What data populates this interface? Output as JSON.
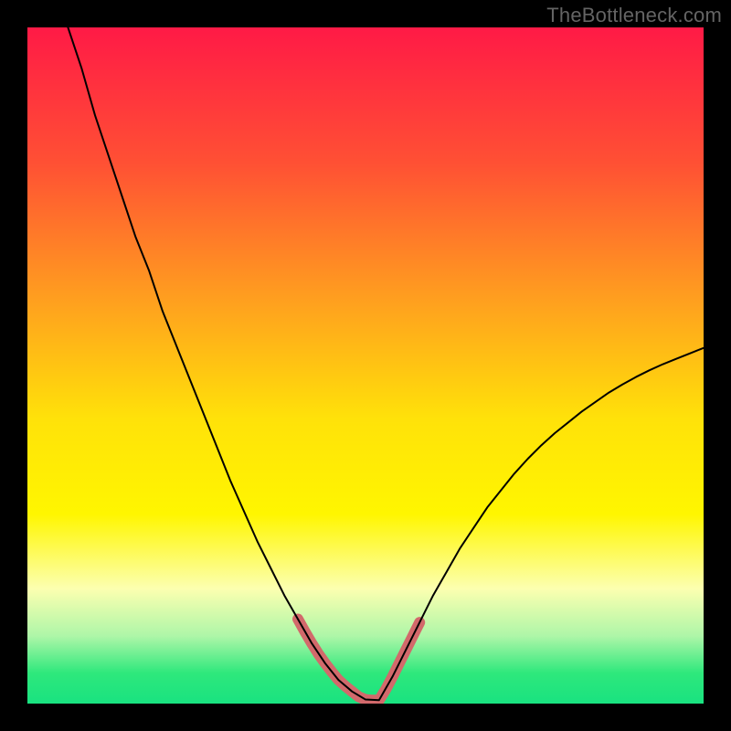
{
  "watermark": "TheBottleneck.com",
  "chart_data": {
    "type": "line",
    "title": "",
    "xlabel": "",
    "ylabel": "",
    "xlim": [
      0,
      100
    ],
    "ylim": [
      0,
      100
    ],
    "gradient_stops": [
      {
        "offset": 0.0,
        "color": "#ff1a46"
      },
      {
        "offset": 0.2,
        "color": "#ff5034"
      },
      {
        "offset": 0.4,
        "color": "#ff9e1f"
      },
      {
        "offset": 0.58,
        "color": "#ffe209"
      },
      {
        "offset": 0.72,
        "color": "#fff600"
      },
      {
        "offset": 0.83,
        "color": "#fcffb0"
      },
      {
        "offset": 0.9,
        "color": "#aef6a8"
      },
      {
        "offset": 0.955,
        "color": "#2ee87c"
      },
      {
        "offset": 1.0,
        "color": "#19e280"
      }
    ],
    "series": [
      {
        "name": "main-curve",
        "color": "#000000",
        "width": 2,
        "x": [
          6,
          8,
          10,
          12,
          14,
          16,
          18,
          20,
          22,
          24,
          26,
          28,
          30,
          32,
          34,
          36,
          38,
          40,
          42,
          44,
          46,
          48,
          50,
          52,
          54,
          56,
          58,
          60,
          62,
          64,
          66,
          68,
          70,
          72,
          74,
          76,
          78,
          80,
          82,
          84,
          86,
          88,
          90,
          92,
          94,
          96,
          98,
          100
        ],
        "y": [
          100,
          94,
          87,
          81,
          75,
          69,
          64,
          58,
          53,
          48,
          43,
          38,
          33,
          28.5,
          24,
          20,
          16,
          12.5,
          9,
          6,
          3.5,
          1.8,
          0.6,
          0.5,
          4,
          8,
          12,
          16,
          19.5,
          23,
          26,
          29,
          31.5,
          34,
          36.2,
          38.2,
          40,
          41.6,
          43.2,
          44.6,
          46,
          47.2,
          48.3,
          49.3,
          50.2,
          51,
          51.8,
          52.6
        ]
      }
    ],
    "highlight_segments": [
      {
        "name": "left-highlight",
        "color": "#d2696b",
        "width": 12,
        "x": [
          40,
          41,
          42,
          43,
          44,
          45,
          46,
          47,
          48
        ],
        "y": [
          12.5,
          10.7,
          9,
          7.4,
          6,
          4.7,
          3.5,
          2.6,
          1.8
        ]
      },
      {
        "name": "bottom-highlight",
        "color": "#d2696b",
        "width": 12,
        "x": [
          48,
          49,
          50,
          51,
          52
        ],
        "y": [
          1.8,
          1.0,
          0.6,
          0.5,
          0.5
        ]
      },
      {
        "name": "right-highlight",
        "color": "#d2696b",
        "width": 12,
        "x": [
          52,
          53,
          54,
          55,
          56,
          57,
          58
        ],
        "y": [
          0.5,
          2.1,
          4,
          6,
          8,
          10,
          12
        ]
      }
    ]
  }
}
